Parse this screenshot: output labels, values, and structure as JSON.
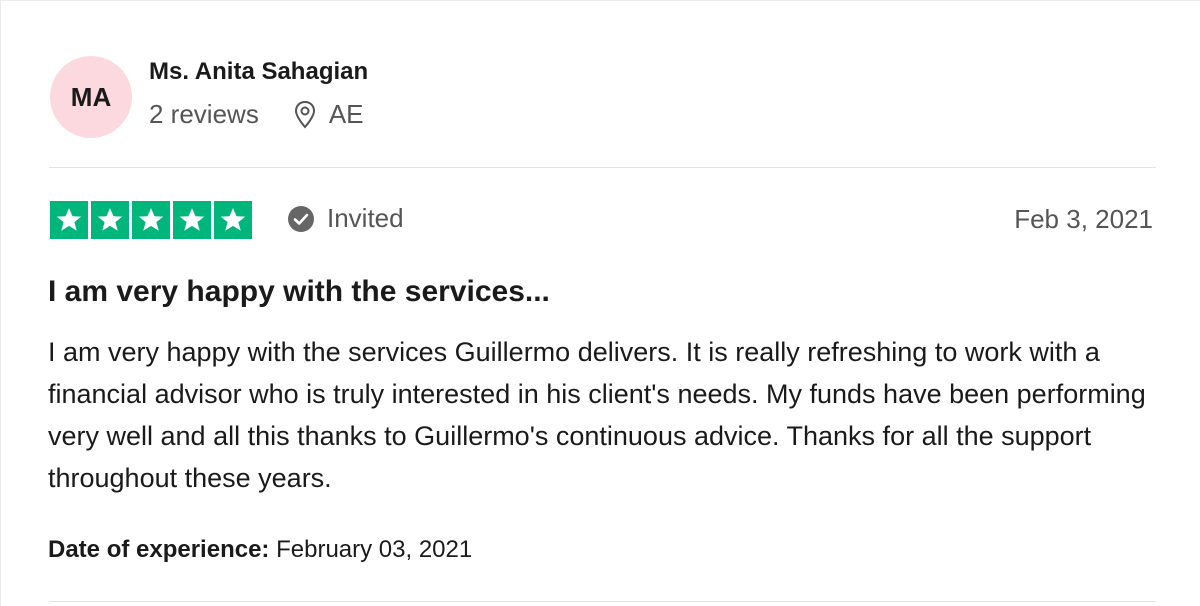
{
  "reviewer": {
    "initials": "MA",
    "name": "Ms. Anita Sahagian",
    "reviews_count": "2 reviews",
    "country": "AE",
    "avatar_color": "#fcd9de"
  },
  "rating": {
    "stars": 5,
    "max_stars": 5,
    "star_color": "#00b67a",
    "status_label": "Invited",
    "date": "Feb 3, 2021"
  },
  "review": {
    "title": "I am very happy with the services...",
    "body": "I am very happy with the services Guillermo delivers. It is really refreshing to work with a financial advisor who is truly interested in his client's needs. My funds have been performing very well and all this thanks to Guillermo's continuous advice. Thanks for all the support throughout these years."
  },
  "experience": {
    "label": "Date of experience:",
    "value": "February 03, 2021"
  }
}
